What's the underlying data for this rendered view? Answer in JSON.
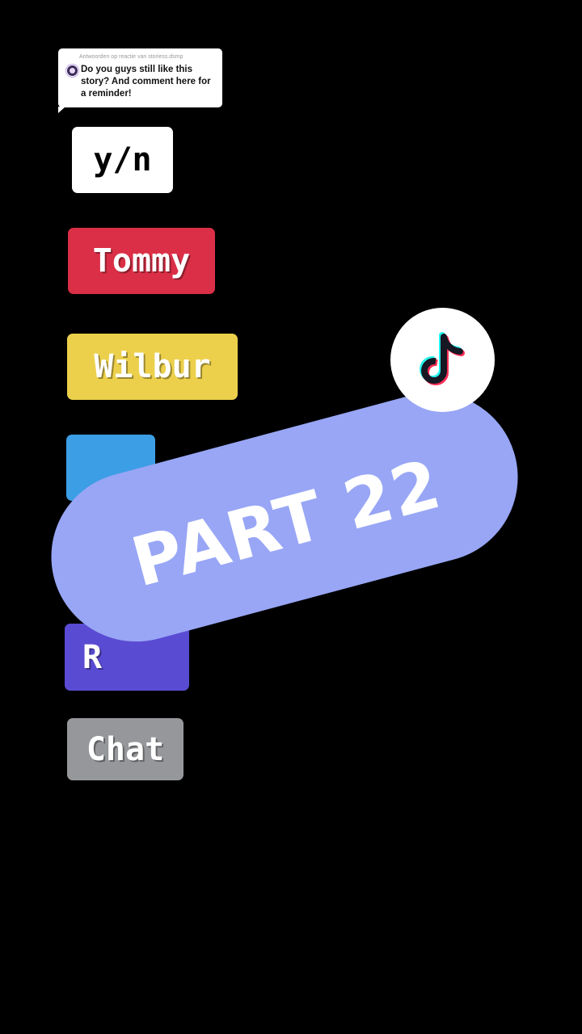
{
  "reply": {
    "header": "Antwoorden op reactie van storiess.dsmp",
    "text": "Do you guys still like this story? And comment here for a reminder!"
  },
  "tags": {
    "yn": "y/n",
    "tommy": "Tommy",
    "wilbur": "Wilbur",
    "purple": "R",
    "chat": "Chat"
  },
  "banner": {
    "text": "PART 22"
  },
  "icons": {
    "logo": "tiktok-logo-icon",
    "avatar": "commenter-avatar"
  },
  "colors": {
    "background": "#000000",
    "tommy": "#da2f46",
    "wilbur": "#ecd04b",
    "blue": "#3c9ee5",
    "purple": "#5a4bd3",
    "chat": "#95979a",
    "banner": "#98a6f5"
  }
}
